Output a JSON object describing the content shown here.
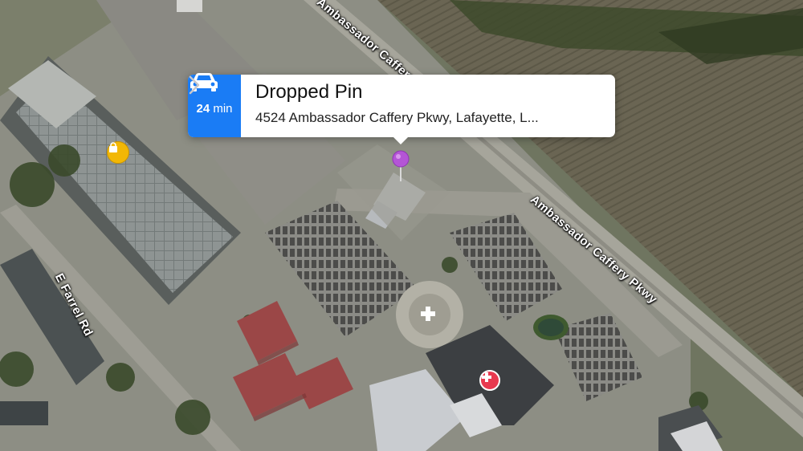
{
  "map": {
    "mode": "satellite",
    "roads": [
      {
        "name": "Ambassador Caffery Pkwy"
      },
      {
        "name": "E Farrel Rd"
      }
    ],
    "pois": [
      {
        "icon": "shopping-bag-icon",
        "color": "#f2b705"
      },
      {
        "icon": "medical-cross-icon",
        "color": "#ffffff"
      },
      {
        "icon": "hospital-icon",
        "color": "#e8394f"
      }
    ],
    "pin": {
      "color": "#b455d6",
      "icon": "dropped-pin-icon"
    }
  },
  "callout": {
    "title": "Dropped Pin",
    "address": "4524 Ambassador Caffery Pkwy, Lafayette, L...",
    "eta_value": "24",
    "eta_unit": "min",
    "eta_icon": "car-icon",
    "eta_color": "#1a7cf5",
    "disclosure_icon": "chevron-right-icon"
  }
}
